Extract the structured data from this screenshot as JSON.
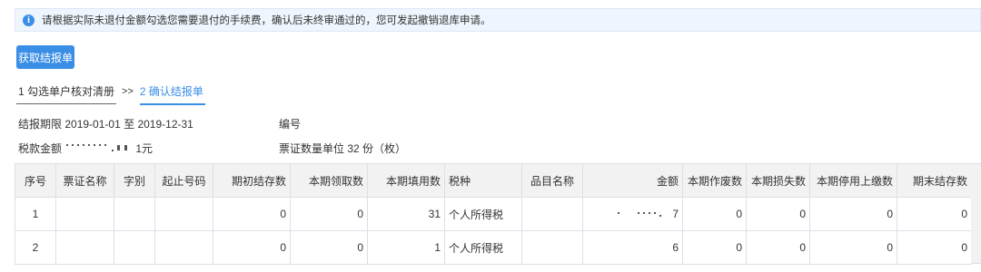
{
  "notice": {
    "icon": "info-icon",
    "text": "请根据实际未退付金额勾选您需要退付的手续费，确认后未终审通过的，您可发起撤销退库申请。"
  },
  "actions": {
    "fetch_label": "获取结报单"
  },
  "steps": [
    {
      "label": "1 勾选单户核对清册",
      "active": false
    },
    {
      "label": "2 确认结报单",
      "active": true
    }
  ],
  "step_separator": ">>",
  "info": {
    "period_label": "结报期限",
    "period_start": "2019-01-01",
    "period_to": "至",
    "period_end": "2019-12-31",
    "number_label": "编号",
    "number_value": "",
    "tax_amount_label": "税款金额",
    "tax_amount_suffix": "1元",
    "ticket_unit_label": "票证数量单位",
    "ticket_unit_value": "32 份（枚）"
  },
  "table": {
    "columns": [
      "序号",
      "票证名称",
      "字别",
      "起止号码",
      "期初结存数",
      "本期领取数",
      "本期填用数",
      "税种",
      "品目名称",
      "金额",
      "本期作废数",
      "本期损失数",
      "本期停用上缴数",
      "期末结存数"
    ],
    "rows": [
      [
        "1",
        "",
        "",
        "",
        "0",
        "0",
        "31",
        "个人所得税",
        "",
        "7",
        "0",
        "0",
        "0",
        "0"
      ],
      [
        "2",
        "",
        "",
        "",
        "0",
        "0",
        "1",
        "个人所得税",
        "",
        "6",
        "0",
        "0",
        "0",
        "0"
      ]
    ]
  },
  "colors": {
    "accent": "#3a8ee6",
    "notice_bg": "#eef5fd",
    "header_bg": "#f2f2f2",
    "border": "#dcdfe6"
  }
}
